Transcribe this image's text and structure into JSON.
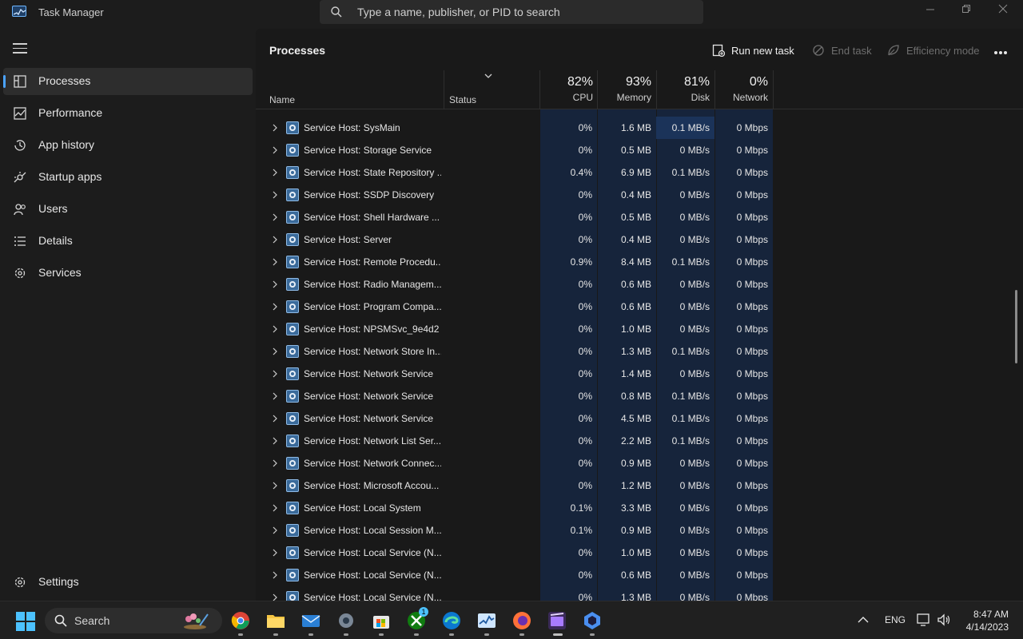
{
  "window": {
    "title": "Task Manager",
    "search_placeholder": "Type a name, publisher, or PID to search"
  },
  "sidebar": {
    "items": [
      {
        "label": "Processes",
        "icon": "processes-icon",
        "active": true
      },
      {
        "label": "Performance",
        "icon": "performance-icon"
      },
      {
        "label": "App history",
        "icon": "app-history-icon"
      },
      {
        "label": "Startup apps",
        "icon": "startup-apps-icon"
      },
      {
        "label": "Users",
        "icon": "users-icon"
      },
      {
        "label": "Details",
        "icon": "details-icon"
      },
      {
        "label": "Services",
        "icon": "services-icon"
      }
    ],
    "settings_label": "Settings"
  },
  "toolbar": {
    "page_title": "Processes",
    "run_new_task": "Run new task",
    "end_task": "End task",
    "efficiency_mode": "Efficiency mode"
  },
  "table": {
    "headers": {
      "name": "Name",
      "status": "Status",
      "cpu_pct": "82%",
      "cpu": "CPU",
      "memory_pct": "93%",
      "memory": "Memory",
      "disk_pct": "81%",
      "disk": "Disk",
      "network_pct": "0%",
      "network": "Network"
    },
    "rows": [
      {
        "name": "Service Host: SysMain",
        "cpu": "0%",
        "memory": "1.6 MB",
        "disk": "0.1 MB/s",
        "network": "0 Mbps"
      },
      {
        "name": "Service Host: Storage Service",
        "cpu": "0%",
        "memory": "0.5 MB",
        "disk": "0 MB/s",
        "network": "0 Mbps"
      },
      {
        "name": "Service Host: State Repository ...",
        "cpu": "0.4%",
        "memory": "6.9 MB",
        "disk": "0.1 MB/s",
        "network": "0 Mbps"
      },
      {
        "name": "Service Host: SSDP Discovery",
        "cpu": "0%",
        "memory": "0.4 MB",
        "disk": "0 MB/s",
        "network": "0 Mbps"
      },
      {
        "name": "Service Host: Shell Hardware ...",
        "cpu": "0%",
        "memory": "0.5 MB",
        "disk": "0 MB/s",
        "network": "0 Mbps"
      },
      {
        "name": "Service Host: Server",
        "cpu": "0%",
        "memory": "0.4 MB",
        "disk": "0 MB/s",
        "network": "0 Mbps"
      },
      {
        "name": "Service Host: Remote Procedu...",
        "cpu": "0.9%",
        "memory": "8.4 MB",
        "disk": "0.1 MB/s",
        "network": "0 Mbps"
      },
      {
        "name": "Service Host: Radio Managem...",
        "cpu": "0%",
        "memory": "0.6 MB",
        "disk": "0 MB/s",
        "network": "0 Mbps"
      },
      {
        "name": "Service Host: Program Compa...",
        "cpu": "0%",
        "memory": "0.6 MB",
        "disk": "0 MB/s",
        "network": "0 Mbps"
      },
      {
        "name": "Service Host: NPSMSvc_9e4d2",
        "cpu": "0%",
        "memory": "1.0 MB",
        "disk": "0 MB/s",
        "network": "0 Mbps"
      },
      {
        "name": "Service Host: Network Store In...",
        "cpu": "0%",
        "memory": "1.3 MB",
        "disk": "0.1 MB/s",
        "network": "0 Mbps"
      },
      {
        "name": "Service Host: Network Service",
        "cpu": "0%",
        "memory": "1.4 MB",
        "disk": "0 MB/s",
        "network": "0 Mbps"
      },
      {
        "name": "Service Host: Network Service",
        "cpu": "0%",
        "memory": "0.8 MB",
        "disk": "0.1 MB/s",
        "network": "0 Mbps"
      },
      {
        "name": "Service Host: Network Service",
        "cpu": "0%",
        "memory": "4.5 MB",
        "disk": "0.1 MB/s",
        "network": "0 Mbps"
      },
      {
        "name": "Service Host: Network List Ser...",
        "cpu": "0%",
        "memory": "2.2 MB",
        "disk": "0.1 MB/s",
        "network": "0 Mbps"
      },
      {
        "name": "Service Host: Network Connec...",
        "cpu": "0%",
        "memory": "0.9 MB",
        "disk": "0 MB/s",
        "network": "0 Mbps"
      },
      {
        "name": "Service Host: Microsoft Accou...",
        "cpu": "0%",
        "memory": "1.2 MB",
        "disk": "0 MB/s",
        "network": "0 Mbps"
      },
      {
        "name": "Service Host: Local System",
        "cpu": "0.1%",
        "memory": "3.3 MB",
        "disk": "0 MB/s",
        "network": "0 Mbps"
      },
      {
        "name": "Service Host: Local Session M...",
        "cpu": "0.1%",
        "memory": "0.9 MB",
        "disk": "0 MB/s",
        "network": "0 Mbps"
      },
      {
        "name": "Service Host: Local Service (N...",
        "cpu": "0%",
        "memory": "1.0 MB",
        "disk": "0 MB/s",
        "network": "0 Mbps"
      },
      {
        "name": "Service Host: Local Service (N...",
        "cpu": "0%",
        "memory": "0.6 MB",
        "disk": "0 MB/s",
        "network": "0 Mbps"
      },
      {
        "name": "Service Host: Local Service (N...",
        "cpu": "0%",
        "memory": "1.3 MB",
        "disk": "0 MB/s",
        "network": "0 Mbps"
      }
    ]
  },
  "taskbar": {
    "search_label": "Search",
    "apps": [
      "chrome-icon",
      "file-explorer-icon",
      "mail-icon",
      "settings-icon",
      "microsoft-store-icon",
      "xbox-icon",
      "edge-icon",
      "task-manager-icon",
      "firefox-icon",
      "clipchamp-icon",
      "copilot-icon"
    ],
    "xbox_badge": "1",
    "language": "ENG",
    "time": "8:47 AM",
    "date": "4/14/2023"
  },
  "colors": {
    "accent": "#4aa3ff",
    "heat_low": "#16243b",
    "heat_mid": "#1b3359"
  }
}
